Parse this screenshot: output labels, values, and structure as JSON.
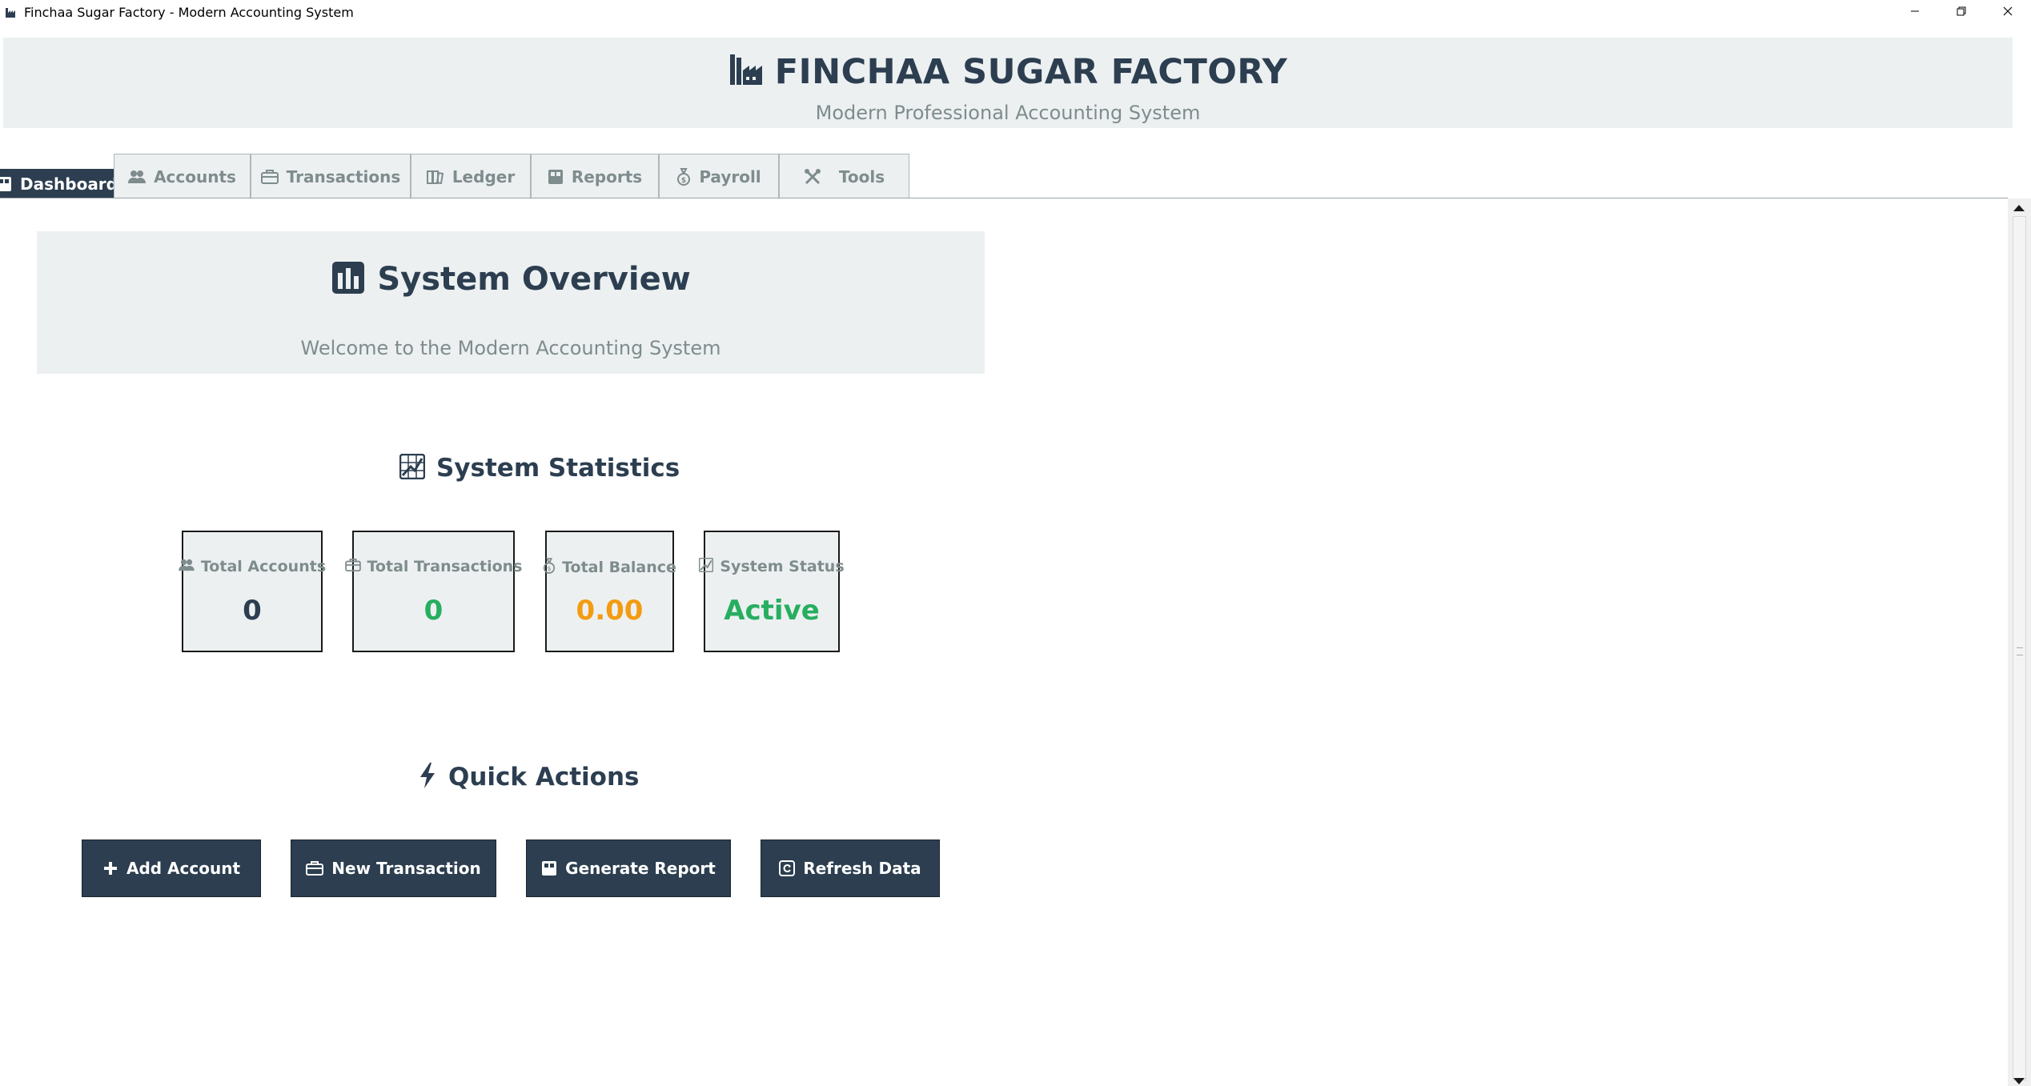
{
  "window": {
    "title": "Finchaa Sugar Factory - Modern Accounting System",
    "icons": [
      "factory-icon",
      "minimize-icon",
      "restore-icon",
      "close-icon"
    ]
  },
  "header": {
    "title": "FINCHAA SUGAR FACTORY",
    "subtitle": "Modern Professional Accounting System",
    "icon": "factory-icon"
  },
  "tabs": [
    {
      "label": "Dashboard",
      "icon": "dashboard-icon",
      "active": true
    },
    {
      "label": "Accounts",
      "icon": "people-icon"
    },
    {
      "label": "Transactions",
      "icon": "briefcase-icon"
    },
    {
      "label": "Ledger",
      "icon": "books-icon"
    },
    {
      "label": "Reports",
      "icon": "report-icon"
    },
    {
      "label": "Payroll",
      "icon": "money-bag-icon"
    },
    {
      "label": "Tools",
      "icon": "tools-icon"
    }
  ],
  "overview": {
    "title": "System Overview",
    "subtitle": "Welcome to the Modern Accounting System",
    "icon": "bar-chart-icon"
  },
  "statistics": {
    "title": "System Statistics",
    "icon": "chart-up-icon",
    "cards": [
      {
        "label": "Total Accounts",
        "value": "0",
        "icon": "people-icon",
        "color": "#2c3e50"
      },
      {
        "label": "Total Transactions",
        "value": "0",
        "icon": "briefcase-icon",
        "color": "#27ae60"
      },
      {
        "label": "Total Balance",
        "value": "0.00",
        "icon": "money-bag-icon",
        "color": "#f39c12"
      },
      {
        "label": "System Status",
        "value": "Active",
        "icon": "chart-up-icon",
        "color": "#27ae60"
      }
    ]
  },
  "quick_actions": {
    "title": "Quick Actions",
    "icon": "lightning-icon",
    "buttons": [
      {
        "label": "Add Account",
        "icon": "plus-icon"
      },
      {
        "label": "New Transaction",
        "icon": "briefcase-icon"
      },
      {
        "label": "Generate Report",
        "icon": "report-icon"
      },
      {
        "label": "Refresh Data",
        "icon": "refresh-icon"
      }
    ]
  },
  "colors": {
    "primary": "#2c3e50",
    "panel": "#ecf0f1",
    "muted": "#7f8c8d",
    "success": "#27ae60",
    "warning": "#f39c12"
  }
}
